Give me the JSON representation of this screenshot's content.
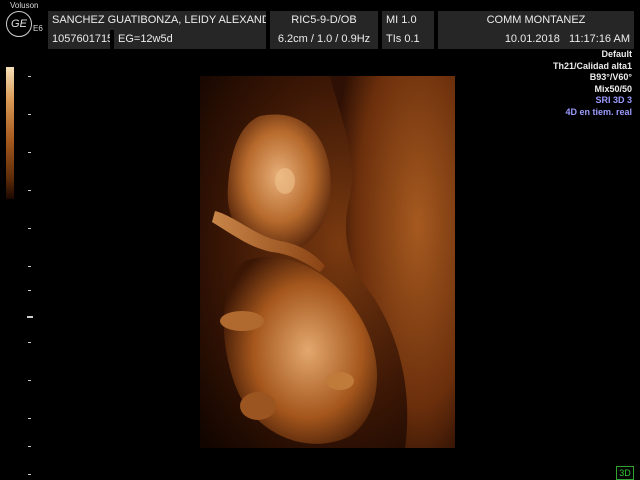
{
  "header": {
    "brand_top": "Voluson",
    "brand_bottom": "E6",
    "logo_text": "GE",
    "patient_name": "SANCHEZ GUATIBONZA, LEIDY ALEXAND",
    "patient_id": "1057601715",
    "gestational_age": "EG=12w5d",
    "probe": "RIC5-9-D/OB",
    "probe_params": "6.2cm / 1.0 / 0.9Hz",
    "mi": "MI  1.0",
    "tis": "TIs  0.1",
    "operator": "COMM MONTANEZ",
    "date": "10.01.2018",
    "time": "11:17:16 AM"
  },
  "settings": {
    "preset": "Default",
    "quality": "Th21/Calidad alta1",
    "angles": "B93°/V60°",
    "mix": "Mix50/50",
    "sri": "SRI 3D 3",
    "mode": "4D en tiem. real"
  },
  "colors": {
    "tissue_light": "#e8b07a",
    "tissue_mid": "#a4561c",
    "tissue_dark": "#3a1605",
    "settings_blue": "#9b9bff",
    "mode_indicator": "#33cc33"
  },
  "icons": {
    "logo": "ge-logo-icon",
    "mode": "3d-mode-icon"
  },
  "footer": {
    "mode_badge": "3D"
  }
}
